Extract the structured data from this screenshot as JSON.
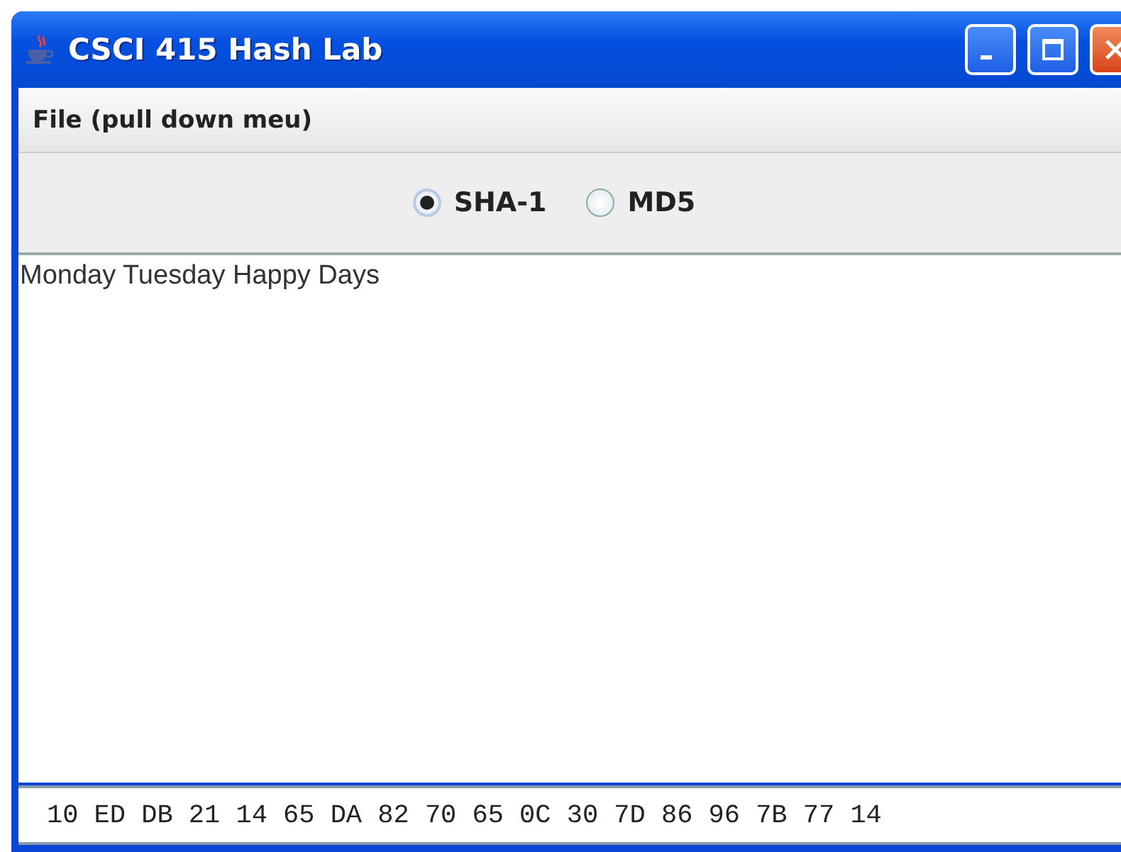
{
  "window": {
    "title": "CSCI 415 Hash Lab"
  },
  "menu": {
    "label": "File (pull down meu)"
  },
  "algorithms": [
    {
      "label": "SHA-1",
      "selected": true
    },
    {
      "label": "MD5",
      "selected": false
    }
  ],
  "input_text": "Monday Tuesday Happy Days",
  "output_text": "10 ED DB 21 14 65 DA 82 70 65 0C 30 7D 86 96 7B 77 14"
}
